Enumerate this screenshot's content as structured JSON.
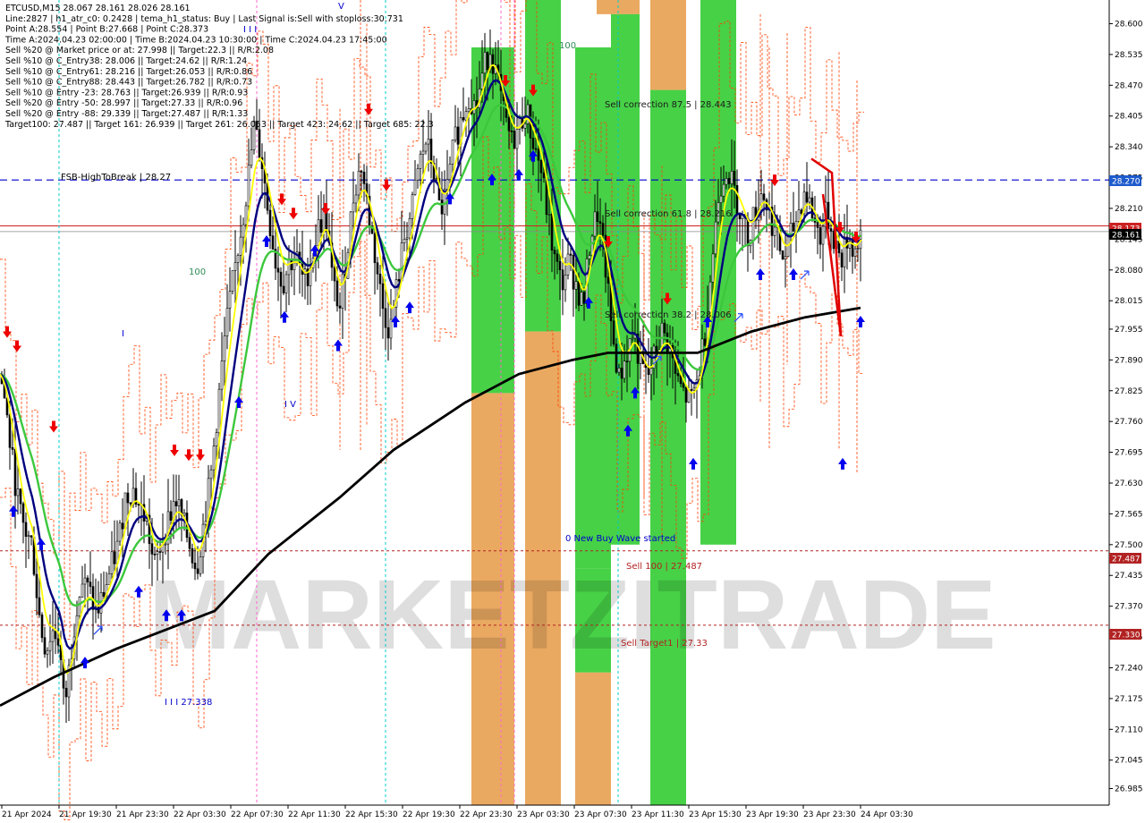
{
  "header": {
    "lines": [
      "ETCUSD,M15  28.067 28.161 28.026 28.161",
      "Line:2827 | h1_atr_c0: 0.2428 | tema_h1_status: Buy | Last Signal is:Sell with stoploss:30.731",
      "Point A:28.554 | Point B:27.668 | Point C:28.373",
      "Time A:2024.04.23 02:00:00 | Time B:2024.04.23 10:30:00 | Time C:2024.04.23 17:45:00",
      "Sell %20 @ Market price or at: 27.998 || Target:22.3 || R/R:2.08",
      "Sell %10 @ C_Entry38: 28.006 || Target:24.62 || R/R:1.24",
      "Sell %10 @ C_Entry61: 28.216 || Target:26.053 || R/R:0.86",
      "Sell %10 @ C_Entry88: 28.443 || Target:26.782 || R/R:0.73",
      "Sell %10 @ Entry -23: 28.763 || Target:26.939 || R/R:0.93",
      "Sell %20 @ Entry -50: 28.997 || Target:27.33 || R/R:0.96",
      "Sell %20 @ Entry -88: 29.339 || Target:27.487 || R/R:1.33",
      "Target100: 27.487 || Target 161: 26.939 || Target 261: 26.053 || Target 423: 24.62 || Target 685: 22.3"
    ]
  },
  "watermark": "MARKETZITRADE",
  "colors": {
    "background": "#ffffff",
    "bull": "#000000",
    "bear": "#000000",
    "ema_fast": "#ffff00",
    "ema_mid": "#00007f",
    "ema_slow": "#3cc83c",
    "ema_long": "#000000",
    "band": "#ff4000",
    "fsb_line": "#0000cd",
    "sell_line": "#b22222",
    "green_zone": "#33cc33",
    "orange_zone": "#e8a050",
    "axis_text": "#000000"
  },
  "annotations": {
    "fsb": "FSB-HighToBreak | 28.27",
    "sell_corr_875": "Sell correction 87.5 | 28.443",
    "sell_corr_618": "Sell correction 61.8 | 28.216",
    "sell_corr_382": "Sell correction 38.2 | 28.006",
    "new_wave": "0 New Buy Wave started",
    "sell100": "Sell 100 | 27.487",
    "sell_target1": "Sell Target1 | 27.33",
    "label_338": "I I I 27.338",
    "label_100a": "100",
    "label_100b": "100",
    "label_I": "I",
    "label_IV": "I V",
    "label_III_top": "I I I",
    "label_V_top": "V"
  },
  "price_tags": {
    "fsb": "28.270",
    "red1": "28.173",
    "current": "28.161",
    "sell100": "27.487",
    "target1": "27.330"
  },
  "chart_data": {
    "type": "candlestick",
    "symbol": "ETCUSD",
    "timeframe": "M15",
    "last_ohlc": {
      "open": 28.067,
      "high": 28.161,
      "low": 28.026,
      "close": 28.161
    },
    "ylim": [
      26.95,
      28.65
    ],
    "y_ticks": [
      28.6,
      28.535,
      28.47,
      28.405,
      28.34,
      28.275,
      28.21,
      28.145,
      28.08,
      28.015,
      27.955,
      27.89,
      27.825,
      27.76,
      27.695,
      27.63,
      27.565,
      27.5,
      27.435,
      27.37,
      27.305,
      27.24,
      27.175,
      27.11,
      27.045,
      26.985
    ],
    "x_labels": [
      "21 Apr 2024",
      "21 Apr 19:30",
      "21 Apr 23:30",
      "22 Apr 03:30",
      "22 Apr 07:30",
      "22 Apr 11:30",
      "22 Apr 15:30",
      "22 Apr 19:30",
      "22 Apr 23:30",
      "23 Apr 03:30",
      "23 Apr 07:30",
      "23 Apr 11:30",
      "23 Apr 15:30",
      "23 Apr 19:30",
      "23 Apr 23:30",
      "24 Apr 03:30"
    ],
    "levels": {
      "fsb_high_to_break": 28.27,
      "sell_100": 27.487,
      "sell_target1": 27.33,
      "sell_corr_875": 28.443,
      "sell_corr_618": 28.216,
      "sell_corr_382": 28.006
    },
    "price_path": [
      [
        0,
        27.86
      ],
      [
        6,
        27.8
      ],
      [
        12,
        27.7
      ],
      [
        18,
        27.62
      ],
      [
        24,
        27.55
      ],
      [
        30,
        27.52
      ],
      [
        36,
        27.5
      ],
      [
        40,
        27.42
      ],
      [
        44,
        27.35
      ],
      [
        48,
        27.3
      ],
      [
        52,
        27.28
      ],
      [
        58,
        27.32
      ],
      [
        66,
        27.3
      ],
      [
        72,
        27.15
      ],
      [
        78,
        27.25
      ],
      [
        86,
        27.38
      ],
      [
        92,
        27.42
      ],
      [
        100,
        27.4
      ],
      [
        108,
        27.35
      ],
      [
        116,
        27.4
      ],
      [
        124,
        27.45
      ],
      [
        132,
        27.5
      ],
      [
        140,
        27.6
      ],
      [
        148,
        27.62
      ],
      [
        156,
        27.58
      ],
      [
        164,
        27.55
      ],
      [
        172,
        27.45
      ],
      [
        180,
        27.5
      ],
      [
        188,
        27.55
      ],
      [
        196,
        27.6
      ],
      [
        204,
        27.55
      ],
      [
        212,
        27.5
      ],
      [
        220,
        27.45
      ],
      [
        228,
        27.55
      ],
      [
        236,
        27.65
      ],
      [
        244,
        27.8
      ],
      [
        252,
        27.95
      ],
      [
        260,
        28.05
      ],
      [
        268,
        28.15
      ],
      [
        276,
        28.25
      ],
      [
        284,
        28.38
      ],
      [
        292,
        28.32
      ],
      [
        300,
        28.2
      ],
      [
        308,
        28.1
      ],
      [
        316,
        28.05
      ],
      [
        324,
        28.1
      ],
      [
        332,
        28.1
      ],
      [
        340,
        28.05
      ],
      [
        348,
        28.1
      ],
      [
        356,
        28.17
      ],
      [
        364,
        28.2
      ],
      [
        372,
        28.05
      ],
      [
        380,
        28.0
      ],
      [
        388,
        28.12
      ],
      [
        396,
        28.25
      ],
      [
        404,
        28.3
      ],
      [
        412,
        28.2
      ],
      [
        420,
        28.1
      ],
      [
        428,
        28.0
      ],
      [
        436,
        27.95
      ],
      [
        444,
        28.05
      ],
      [
        452,
        28.15
      ],
      [
        460,
        28.2
      ],
      [
        468,
        28.3
      ],
      [
        476,
        28.35
      ],
      [
        484,
        28.3
      ],
      [
        492,
        28.2
      ],
      [
        500,
        28.25
      ],
      [
        508,
        28.35
      ],
      [
        516,
        28.4
      ],
      [
        524,
        28.45
      ],
      [
        532,
        28.42
      ],
      [
        540,
        28.5
      ],
      [
        548,
        28.55
      ],
      [
        556,
        28.48
      ],
      [
        564,
        28.4
      ],
      [
        572,
        28.35
      ],
      [
        580,
        28.38
      ],
      [
        588,
        28.42
      ],
      [
        596,
        28.35
      ],
      [
        604,
        28.3
      ],
      [
        612,
        28.2
      ],
      [
        620,
        28.1
      ],
      [
        628,
        28.05
      ],
      [
        636,
        28.1
      ],
      [
        644,
        28.05
      ],
      [
        652,
        28.0
      ],
      [
        660,
        28.15
      ],
      [
        668,
        28.2
      ],
      [
        676,
        28.1
      ],
      [
        684,
        27.95
      ],
      [
        692,
        27.85
      ],
      [
        700,
        27.9
      ],
      [
        708,
        27.95
      ],
      [
        716,
        27.88
      ],
      [
        724,
        27.85
      ],
      [
        732,
        27.9
      ],
      [
        740,
        27.95
      ],
      [
        748,
        27.92
      ],
      [
        756,
        27.85
      ],
      [
        764,
        27.82
      ],
      [
        772,
        27.8
      ],
      [
        780,
        27.85
      ],
      [
        788,
        27.95
      ],
      [
        796,
        28.1
      ],
      [
        804,
        28.25
      ],
      [
        812,
        28.3
      ],
      [
        820,
        28.25
      ],
      [
        828,
        28.2
      ],
      [
        836,
        28.15
      ],
      [
        844,
        28.2
      ],
      [
        852,
        28.25
      ],
      [
        860,
        28.2
      ],
      [
        868,
        28.15
      ],
      [
        876,
        28.1
      ],
      [
        884,
        28.15
      ],
      [
        892,
        28.2
      ],
      [
        900,
        28.25
      ],
      [
        908,
        28.2
      ],
      [
        916,
        28.15
      ],
      [
        924,
        28.2
      ],
      [
        932,
        28.15
      ],
      [
        940,
        28.1
      ],
      [
        948,
        28.15
      ],
      [
        956,
        28.12
      ],
      [
        962,
        28.16
      ]
    ]
  }
}
